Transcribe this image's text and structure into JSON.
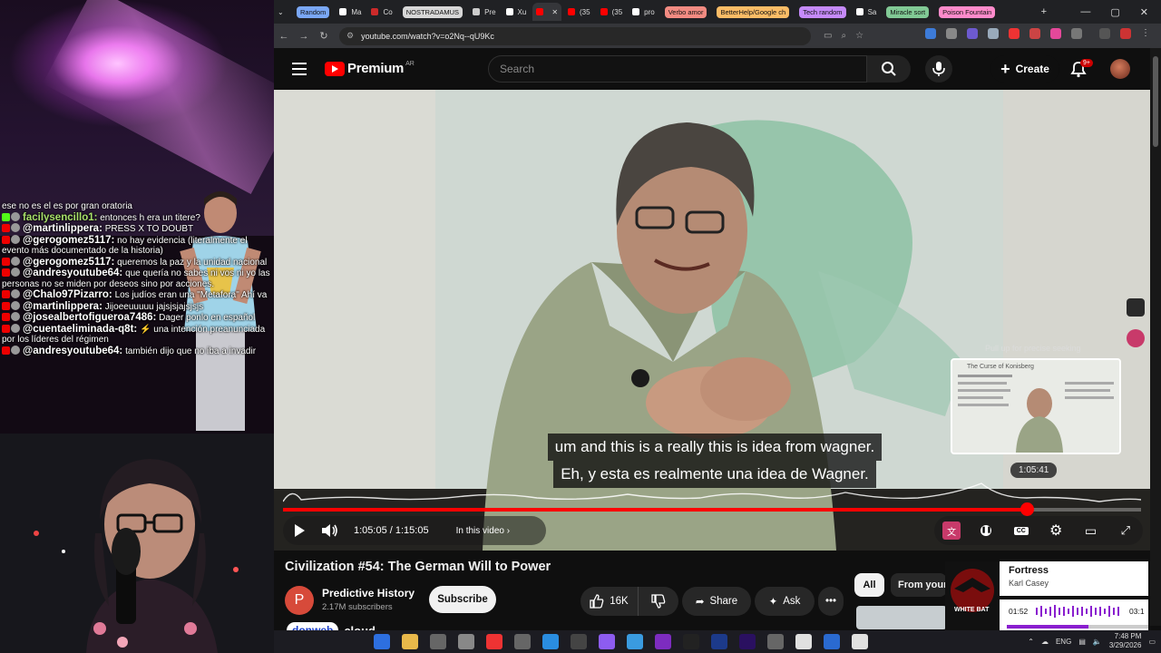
{
  "browser": {
    "tabs": [
      {
        "label": "Random",
        "kind": "chip",
        "color": "#7aa7f5"
      },
      {
        "label": "Ma",
        "kind": "tab",
        "icon": "x-icon",
        "color": "#ffffff"
      },
      {
        "label": "Co",
        "kind": "tab",
        "icon": "reddit-icon",
        "color": "#cc2a2a"
      },
      {
        "label": "NOSTRADAMUS",
        "kind": "chip",
        "color": "#d7d7d7"
      },
      {
        "label": "Pre",
        "kind": "tab",
        "icon": "globe-icon",
        "color": "#cccccc"
      },
      {
        "label": "Xu",
        "kind": "tab",
        "icon": "chat-icon",
        "color": "#ffffff"
      },
      {
        "label": "",
        "kind": "active",
        "icon": "youtube-icon",
        "color": "#ff0000"
      },
      {
        "label": "(35",
        "kind": "tab",
        "icon": "youtube-icon",
        "color": "#ff0000"
      },
      {
        "label": "(35",
        "kind": "tab",
        "icon": "youtube-icon",
        "color": "#ff0000"
      },
      {
        "label": "pro",
        "kind": "tab",
        "icon": "google-icon",
        "color": "#ffffff"
      },
      {
        "label": "Verbo amor",
        "kind": "chip",
        "color": "#f28b82"
      },
      {
        "label": "BetterHelp/Google ch",
        "kind": "chip",
        "color": "#fbbc66"
      },
      {
        "label": "Tech random",
        "kind": "chip",
        "color": "#c58af9"
      },
      {
        "label": "Sa",
        "kind": "tab",
        "icon": "x-icon",
        "color": "#ffffff"
      },
      {
        "label": "Miracle sort",
        "kind": "chip",
        "color": "#81c995"
      },
      {
        "label": "Poison Fountain",
        "kind": "chip",
        "color": "#ff8bcb"
      }
    ],
    "url": "youtube.com/watch?v=o2Nq--qU9Kc"
  },
  "youtube": {
    "logo_text": "Premium",
    "region": "AR",
    "search_placeholder": "Search",
    "create_label": "Create",
    "notification_count": "9+"
  },
  "player": {
    "subtitle_en": "um and this is a really this is idea from wagner.",
    "subtitle_es": "Eh, y esta es realmente una idea de Wagner.",
    "seek_hint": "Pull up for precise seeking",
    "preview_time": "1:05:41",
    "current_time": "1:05:05",
    "duration": "1:15:05",
    "time_display": "1:05:05 / 1:15:05",
    "progress": 0.867,
    "in_this_video": "In this video",
    "preview_slide_title": "The Curse of Konisberg"
  },
  "video": {
    "title": "Civilization #54: The German Will to Power",
    "channel_name": "Predictive History",
    "channel_initial": "P",
    "subscribers": "2.17M subscribers",
    "subscribe_label": "Subscribe",
    "likes": "16K",
    "share_label": "Share",
    "ask_label": "Ask"
  },
  "sidebar_chips": {
    "all": "All",
    "from_your": "From your"
  },
  "music": {
    "title": "Fortress",
    "artist": "Karl Casey",
    "current": "01:52",
    "length": "03:1",
    "progress": 0.58,
    "album_text": "WHITE BAT"
  },
  "brand": {
    "logo": "donweb",
    "suffix": "cloud"
  },
  "chat": {
    "messages": [
      {
        "user": "",
        "text": "ese no es el es por gran oratoria",
        "platform": "none"
      },
      {
        "user": "facilysencillo1:",
        "text": "entonces h era un titere?",
        "platform": "kick"
      },
      {
        "user": "@martinlippera:",
        "text": "PRESS X TO DOUBT",
        "platform": "youtube"
      },
      {
        "user": "@gerogomez5117:",
        "text": "no hay evidencia (literalmente el evento más documentado de la historia)",
        "platform": "youtube"
      },
      {
        "user": "@gerogomez5117:",
        "text": "queremos la paz y la unidad nacional",
        "platform": "youtube"
      },
      {
        "user": "@andresyoutube64:",
        "text": "que quería no sabes ni vos ni yo las personas no se miden por deseos sino por acciones.",
        "platform": "youtube"
      },
      {
        "user": "@Chalo97Pizarro:",
        "text": "Los judíos eran una \"Metafora\" Ahí va",
        "platform": "youtube"
      },
      {
        "user": "@martinlippera:",
        "text": "Jijoeeuuuuu jajsjsjajsjsjs",
        "platform": "youtube"
      },
      {
        "user": "@josealbertofigueroa7486:",
        "text": "Dager ponlo en español",
        "platform": "youtube"
      },
      {
        "user": "@cuentaeliminada-q8t:",
        "text": "⚡ una intención preanunciada por los líderes del régimen",
        "platform": "youtube"
      },
      {
        "user": "@andresyoutube64:",
        "text": "también dijo que no iba a invadir",
        "platform": "youtube"
      }
    ]
  },
  "taskbar": {
    "lang": "ENG",
    "time": "7:48 PM",
    "date": "3/29/2026"
  }
}
